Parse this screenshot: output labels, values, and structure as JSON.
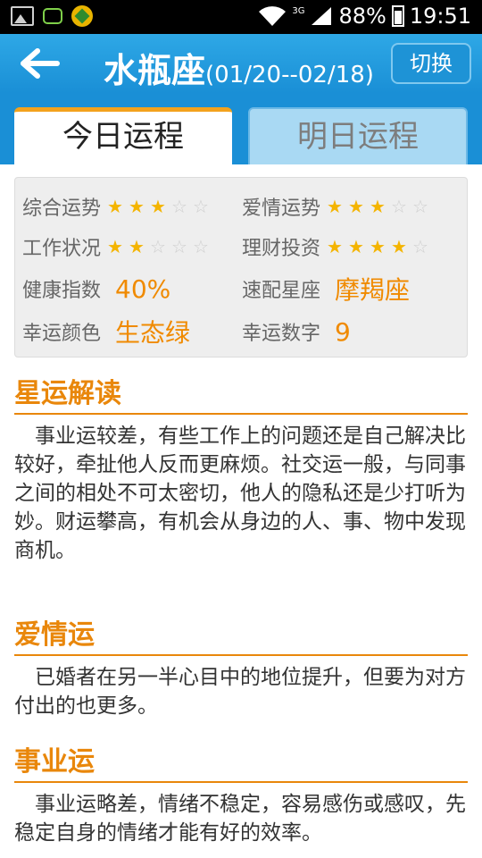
{
  "status_bar": {
    "network_label": "3G",
    "battery": "88%",
    "time": "19:51",
    "icons": [
      "gallery-icon",
      "chat-icon",
      "game-icon",
      "wifi-icon",
      "signal-icon",
      "battery-icon"
    ]
  },
  "header": {
    "title": "水瓶座",
    "date_range": "(01/20--02/18)",
    "switch_label": "切换"
  },
  "tabs": [
    {
      "label": "今日运程",
      "active": true
    },
    {
      "label": "明日运程",
      "active": false
    }
  ],
  "info": {
    "overall": {
      "label": "综合运势",
      "stars": 3,
      "max": 5
    },
    "love": {
      "label": "爱情运势",
      "stars": 3,
      "max": 5
    },
    "work": {
      "label": "工作状况",
      "stars": 2,
      "max": 5
    },
    "finance": {
      "label": "理财投资",
      "stars": 4,
      "max": 5
    },
    "health": {
      "label": "健康指数",
      "value": "40%"
    },
    "match": {
      "label": "速配星座",
      "value": "摩羯座"
    },
    "lucky_color": {
      "label": "幸运颜色",
      "value": "生态绿"
    },
    "lucky_number": {
      "label": "幸运数字",
      "value": "9"
    }
  },
  "sections": [
    {
      "title": "星运解读",
      "body": "事业运较差，有些工作上的问题还是自己解决比较好，牵扯他人反而更麻烦。社交运一般，与同事之间的相处不可太密切，他人的隐私还是少打听为妙。财运攀高，有机会从身边的人、事、物中发现商机。"
    },
    {
      "title": "爱情运",
      "body": "已婚者在另一半心目中的地位提升，但要为对方付出的也更多。"
    },
    {
      "title": "事业运",
      "body": "事业运略差，情绪不稳定，容易感伤或感叹，先稳定自身的情绪才能有好的效率。"
    }
  ],
  "colors": {
    "header_blue": "#1a8fd6",
    "accent_orange": "#e9870b",
    "star_gold": "#f4b400"
  }
}
